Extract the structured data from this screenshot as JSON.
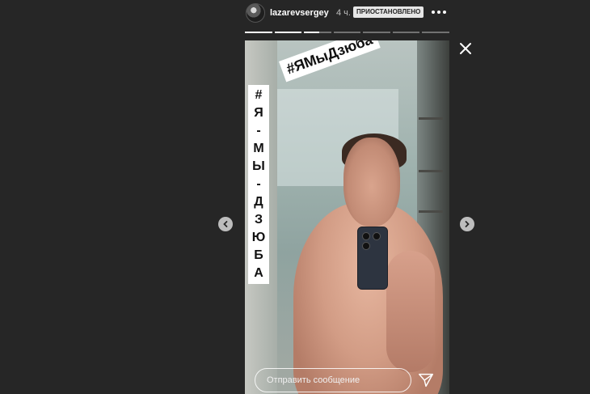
{
  "header": {
    "username": "lazarevsergey",
    "time": "4 ч.",
    "status_badge": "ПРИОСТАНОВЛЕНО"
  },
  "progress": {
    "segments": 7,
    "current_index": 2,
    "current_fill": 0.55
  },
  "story": {
    "vertical_tag": [
      "#",
      "Я",
      "-",
      "М",
      "Ы",
      "-",
      "Д",
      "З",
      "Ю",
      "Б",
      "А"
    ],
    "horizontal_tag": "#ЯМыДзюба"
  },
  "message": {
    "placeholder": "Отправить сообщение"
  },
  "icons": {
    "close": "close-icon",
    "send": "send-icon",
    "more": "more-icon",
    "prev": "chevron-left-icon",
    "next": "chevron-right-icon"
  },
  "colors": {
    "background": "#262626",
    "text": "#ffffff",
    "muted": "#bdbdbd"
  }
}
